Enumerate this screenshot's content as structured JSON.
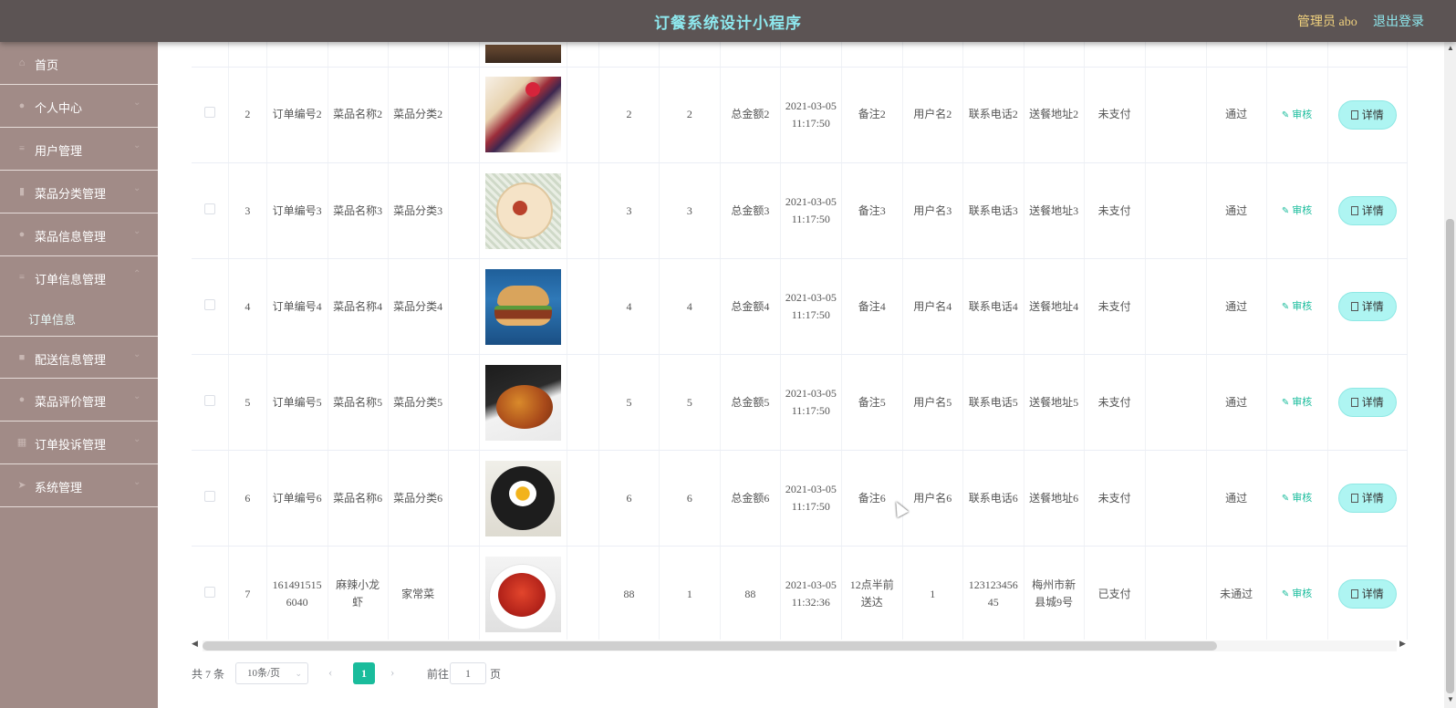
{
  "header": {
    "title": "订餐系统设计小程序",
    "admin": "管理员 abo",
    "logout": "退出登录"
  },
  "sidebar": {
    "items": [
      {
        "label": "首页",
        "icon": "home-icon",
        "arrow": false
      },
      {
        "label": "个人中心",
        "icon": "user-icon",
        "arrow": true
      },
      {
        "label": "用户管理",
        "icon": "list-icon",
        "arrow": true
      },
      {
        "label": "菜品分类管理",
        "icon": "bar-chart-icon",
        "arrow": true
      },
      {
        "label": "菜品信息管理",
        "icon": "dish-icon",
        "arrow": true
      },
      {
        "label": "订单信息管理",
        "icon": "list-icon",
        "arrow": true
      },
      {
        "label": "配送信息管理",
        "icon": "truck-icon",
        "arrow": true
      },
      {
        "label": "菜品评价管理",
        "icon": "user-icon",
        "arrow": true
      },
      {
        "label": "订单投诉管理",
        "icon": "grid-icon",
        "arrow": true
      },
      {
        "label": "系统管理",
        "icon": "send-icon",
        "arrow": true
      }
    ],
    "submenu_active": "订单信息"
  },
  "table": {
    "audit_label": "审核",
    "detail_label": "详情",
    "rows": [
      {
        "id": "2",
        "order_no": "订单编号2",
        "dish": "菜品名称2",
        "category": "菜品分类2",
        "price": "2",
        "qty": "2",
        "total": "总金额2",
        "time": "2021-03-05 11:17:50",
        "note": "备注2",
        "user": "用户名2",
        "phone": "联系电话2",
        "address": "送餐地址2",
        "pay": "未支付",
        "status": "通过"
      },
      {
        "id": "3",
        "order_no": "订单编号3",
        "dish": "菜品名称3",
        "category": "菜品分类3",
        "price": "3",
        "qty": "3",
        "total": "总金额3",
        "time": "2021-03-05 11:17:50",
        "note": "备注3",
        "user": "用户名3",
        "phone": "联系电话3",
        "address": "送餐地址3",
        "pay": "未支付",
        "status": "通过"
      },
      {
        "id": "4",
        "order_no": "订单编号4",
        "dish": "菜品名称4",
        "category": "菜品分类4",
        "price": "4",
        "qty": "4",
        "total": "总金额4",
        "time": "2021-03-05 11:17:50",
        "note": "备注4",
        "user": "用户名4",
        "phone": "联系电话4",
        "address": "送餐地址4",
        "pay": "未支付",
        "status": "通过"
      },
      {
        "id": "5",
        "order_no": "订单编号5",
        "dish": "菜品名称5",
        "category": "菜品分类5",
        "price": "5",
        "qty": "5",
        "total": "总金额5",
        "time": "2021-03-05 11:17:50",
        "note": "备注5",
        "user": "用户名5",
        "phone": "联系电话5",
        "address": "送餐地址5",
        "pay": "未支付",
        "status": "通过"
      },
      {
        "id": "6",
        "order_no": "订单编号6",
        "dish": "菜品名称6",
        "category": "菜品分类6",
        "price": "6",
        "qty": "6",
        "total": "总金额6",
        "time": "2021-03-05 11:17:50",
        "note": "备注6",
        "user": "用户名6",
        "phone": "联系电话6",
        "address": "送餐地址6",
        "pay": "未支付",
        "status": "通过"
      },
      {
        "id": "7",
        "order_no": "1614915156040",
        "dish": "麻辣小龙虾",
        "category": "家常菜",
        "price": "88",
        "qty": "1",
        "total": "88",
        "time": "2021-03-05 11:32:36",
        "note": "12点半前送达",
        "user": "1",
        "phone": "12312345645",
        "address": "梅州市新县城9号",
        "pay": "已支付",
        "status": "未通过"
      }
    ]
  },
  "pagination": {
    "total": "共 7 条",
    "page_size": "10条/页",
    "current": "1",
    "goto_label": "前往",
    "goto_value": "1",
    "page_unit": "页"
  },
  "colors": {
    "header_bg": "#5c5454",
    "sidebar_bg": "#a18b87",
    "accent": "#1abc9c",
    "title": "#8ee8ee",
    "admin": "#f1d27e"
  }
}
